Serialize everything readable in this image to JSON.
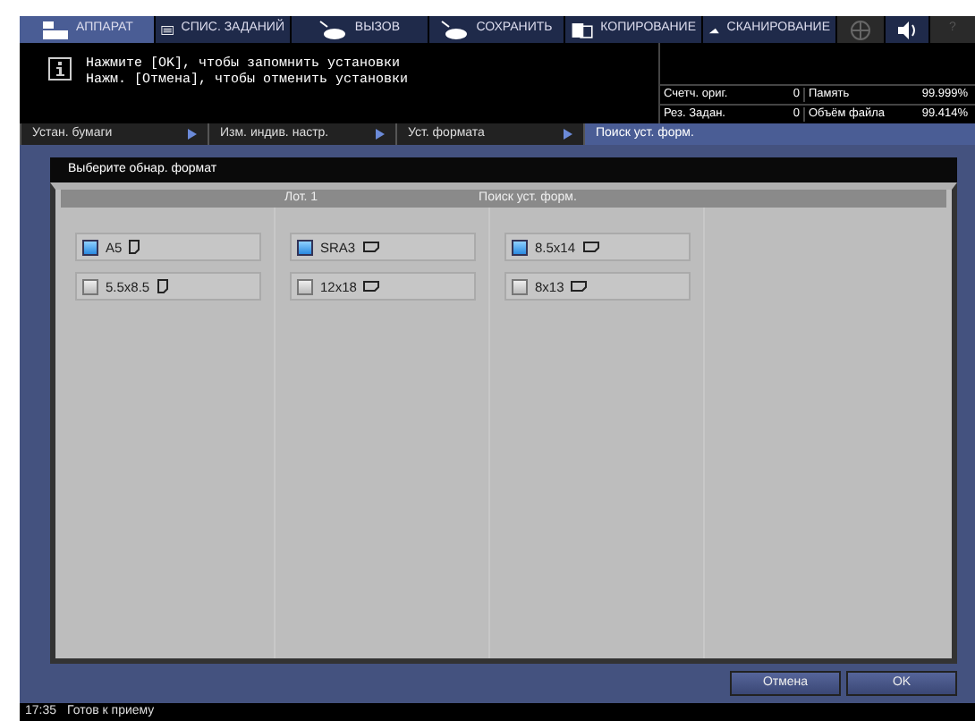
{
  "tabs": [
    {
      "label": "АППАРАТ",
      "kind": "machine",
      "selected": true,
      "disabled": false
    },
    {
      "label": "СПИС. ЗАДАНИЙ",
      "kind": "list",
      "selected": false,
      "disabled": false
    },
    {
      "label": "ВЫЗОВ",
      "kind": "recall",
      "selected": false,
      "disabled": false
    },
    {
      "label": "СОХРАНИТЬ",
      "kind": "store",
      "selected": false,
      "disabled": false
    },
    {
      "label": "КОПИРОВАНИЕ",
      "kind": "copy",
      "selected": false,
      "disabled": false
    },
    {
      "label": "СКАНИРОВАНИЕ",
      "kind": "scan",
      "selected": false,
      "disabled": false
    },
    {
      "kind": "globe",
      "selected": false,
      "disabled": true
    },
    {
      "kind": "speaker",
      "selected": false,
      "disabled": false
    },
    {
      "label": "?",
      "kind": "help",
      "selected": false,
      "disabled": true
    }
  ],
  "message": {
    "lines": [
      "Нажмите [OK], чтобы запомнить установки",
      "Нажм. [Отмена], чтобы отменить установки"
    ]
  },
  "counters": [
    {
      "label": "Счетч. ориг.",
      "value": "0",
      "label_2": "Память",
      "value_2": "99.999%"
    },
    {
      "label": "Рез. Задан.",
      "value": "0",
      "label_2": "Объём файла",
      "value_2": "99.414%"
    }
  ],
  "breadcrumb": [
    {
      "label": "Устан. бумаги",
      "selected": false
    },
    {
      "label": "Изм. индив. настр.",
      "selected": false
    },
    {
      "label": "Уст. формата",
      "selected": false
    },
    {
      "label": "Поиск уст. форм.",
      "selected": true
    }
  ],
  "panel": {
    "title": "Выберите обнар. формат",
    "header": [
      "Лот. 1",
      "Поиск уст. форм."
    ],
    "columns": [
      [
        {
          "label": "A5",
          "kind": "portrait",
          "checked": true
        },
        {
          "label": "5.5x8.5",
          "kind": "portrait",
          "checked": false
        }
      ],
      [
        {
          "label": "SRA3",
          "kind": "landscape",
          "checked": true
        },
        {
          "label": "12x18",
          "kind": "landscape",
          "checked": false
        }
      ],
      [
        {
          "label": "8.5x14",
          "kind": "landscape",
          "checked": true
        },
        {
          "label": "8x13",
          "kind": "landscape",
          "checked": false
        }
      ]
    ]
  },
  "buttons": [
    "Отмена",
    "OK"
  ],
  "status_bar": {
    "time": "17:35",
    "text": "Готов к приему"
  }
}
